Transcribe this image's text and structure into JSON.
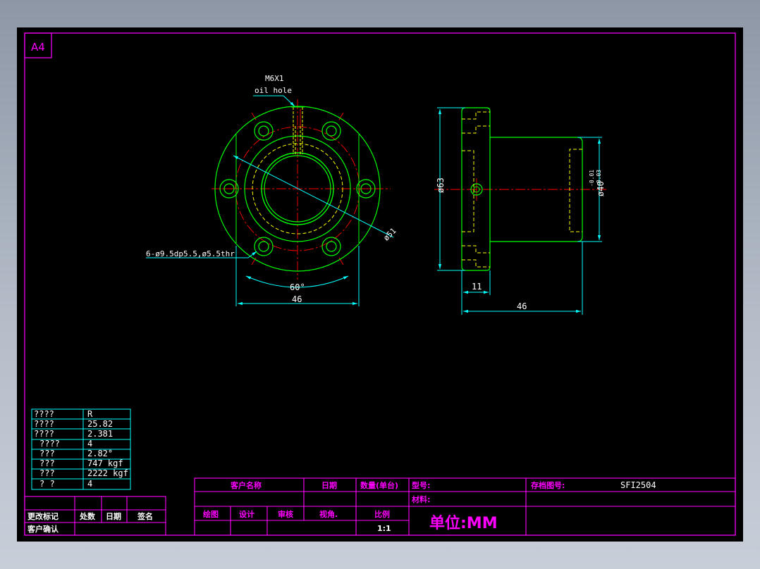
{
  "sheet": {
    "size_label": "A4"
  },
  "front_view": {
    "oil_hole_thread": "M6X1",
    "oil_hole_label": "oil hole",
    "bolt_hole_note": "6-ø9.5dp5.5,ø5.5thr",
    "pcd_label": "ø51",
    "angle_label": "60°",
    "width_dim": "46"
  },
  "side_view": {
    "flange_dia": "ø63",
    "body_dia": "ø40",
    "body_tol_upper": "-0.01",
    "body_tol_lower": "-0.03",
    "flange_thk": "11",
    "length_dim": "46"
  },
  "spec_table": [
    {
      "key": "????",
      "value": "R"
    },
    {
      "key": "????",
      "value": "25.82"
    },
    {
      "key": "????",
      "value": "2.381"
    },
    {
      "key": "????",
      "value": "4"
    },
    {
      "key": "???",
      "value": "2.82°"
    },
    {
      "key": "???",
      "value": "747 kgf"
    },
    {
      "key": "???",
      "value": "2222 kgf"
    },
    {
      "key": "?  ?",
      "value": "4"
    }
  ],
  "revision_block": {
    "change_mark": "更改标记",
    "count": "处数",
    "date": "日期",
    "sign": "签名",
    "customer_confirm": "客户确认"
  },
  "title_block": {
    "customer_name": "客户名称",
    "date": "日期",
    "qty": "数量(单台)",
    "model": "型号:",
    "archive_no_label": "存档图号:",
    "archive_no": "SFI2504",
    "material": "材料:",
    "drawn": "绘图",
    "design": "设计",
    "check": "审核",
    "view_angle": "视角.",
    "scale_label": "比例",
    "scale": "1:1",
    "unit": "单位:MM"
  },
  "colors": {
    "frame": "#ff00ff",
    "outline": "#00ff00",
    "dimension": "#00ffff",
    "center": "#ff0000",
    "hidden": "#ffff00",
    "text": "#ffffff"
  }
}
